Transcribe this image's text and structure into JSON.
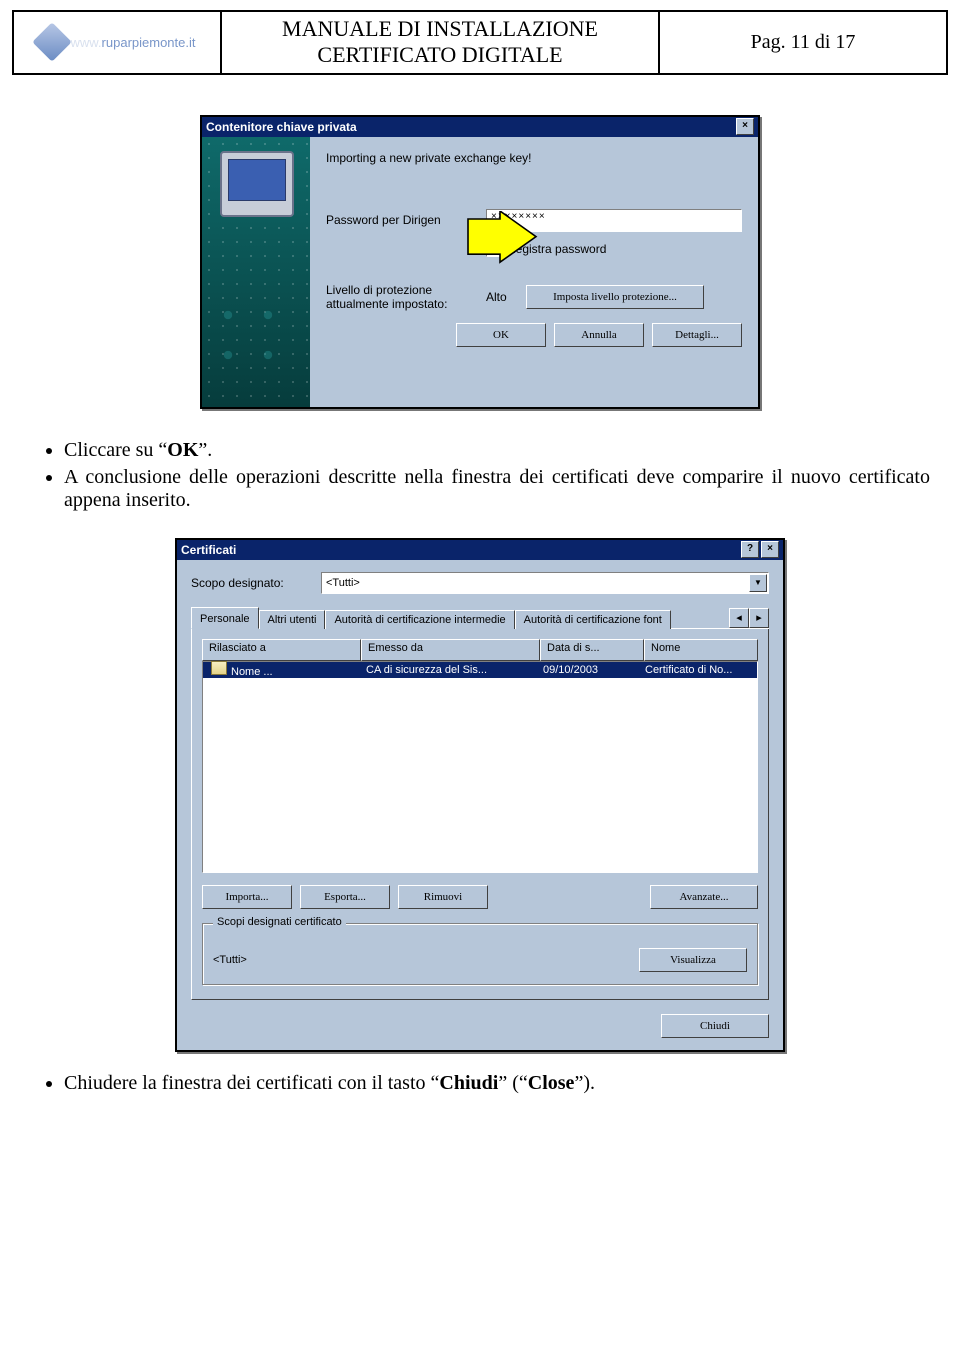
{
  "header": {
    "logo_text": "ruparpiemonte.it",
    "title_line1": "MANUALE DI INSTALLAZIONE",
    "title_line2": "CERTIFICATO DIGITALE",
    "page_label": "Pag. 11 di 17"
  },
  "dialog1": {
    "title": "Contenitore chiave privata",
    "message": "Importing a new private exchange key!",
    "password_label": "Password per Dirigen",
    "password_value": "××××××××",
    "remember_label": "Registra password",
    "protection_label_l1": "Livello di protezione",
    "protection_label_l2": "attualmente impostato:",
    "protection_value": "Alto",
    "set_protection_btn": "Imposta livello protezione...",
    "ok": "OK",
    "cancel": "Annulla",
    "details": "Dettagli..."
  },
  "body1": {
    "bullet1_a": "Cliccare su “",
    "bullet1_b": "OK",
    "bullet1_c": "”.",
    "bullet2": "A conclusione delle operazioni descritte nella finestra dei certificati deve comparire il nuovo certificato appena inserito."
  },
  "dialog2": {
    "title": "Certificati",
    "scope_label": "Scopo designato:",
    "scope_value": "<Tutti>",
    "tabs": [
      "Personale",
      "Altri utenti",
      "Autorità di certificazione intermedie",
      "Autorità di certificazione font"
    ],
    "headers": [
      "Rilasciato a",
      "Emesso da",
      "Data di s...",
      "Nome"
    ],
    "row": {
      "issued_to": "Nome ...",
      "issued_by": "CA di sicurezza del Sis...",
      "date": "09/10/2003",
      "name": "Certificato di No..."
    },
    "import": "Importa...",
    "export": "Esporta...",
    "remove": "Rimuovi",
    "advanced": "Avanzate...",
    "group_legend": "Scopi designati certificato",
    "group_value": "<Tutti>",
    "view": "Visualizza",
    "close": "Chiudi"
  },
  "body2": {
    "bullet_a": "Chiudere la finestra dei certificati con il tasto “",
    "bullet_b": "Chiudi",
    "bullet_c": "” (“",
    "bullet_d": "Close",
    "bullet_e": "”)."
  }
}
